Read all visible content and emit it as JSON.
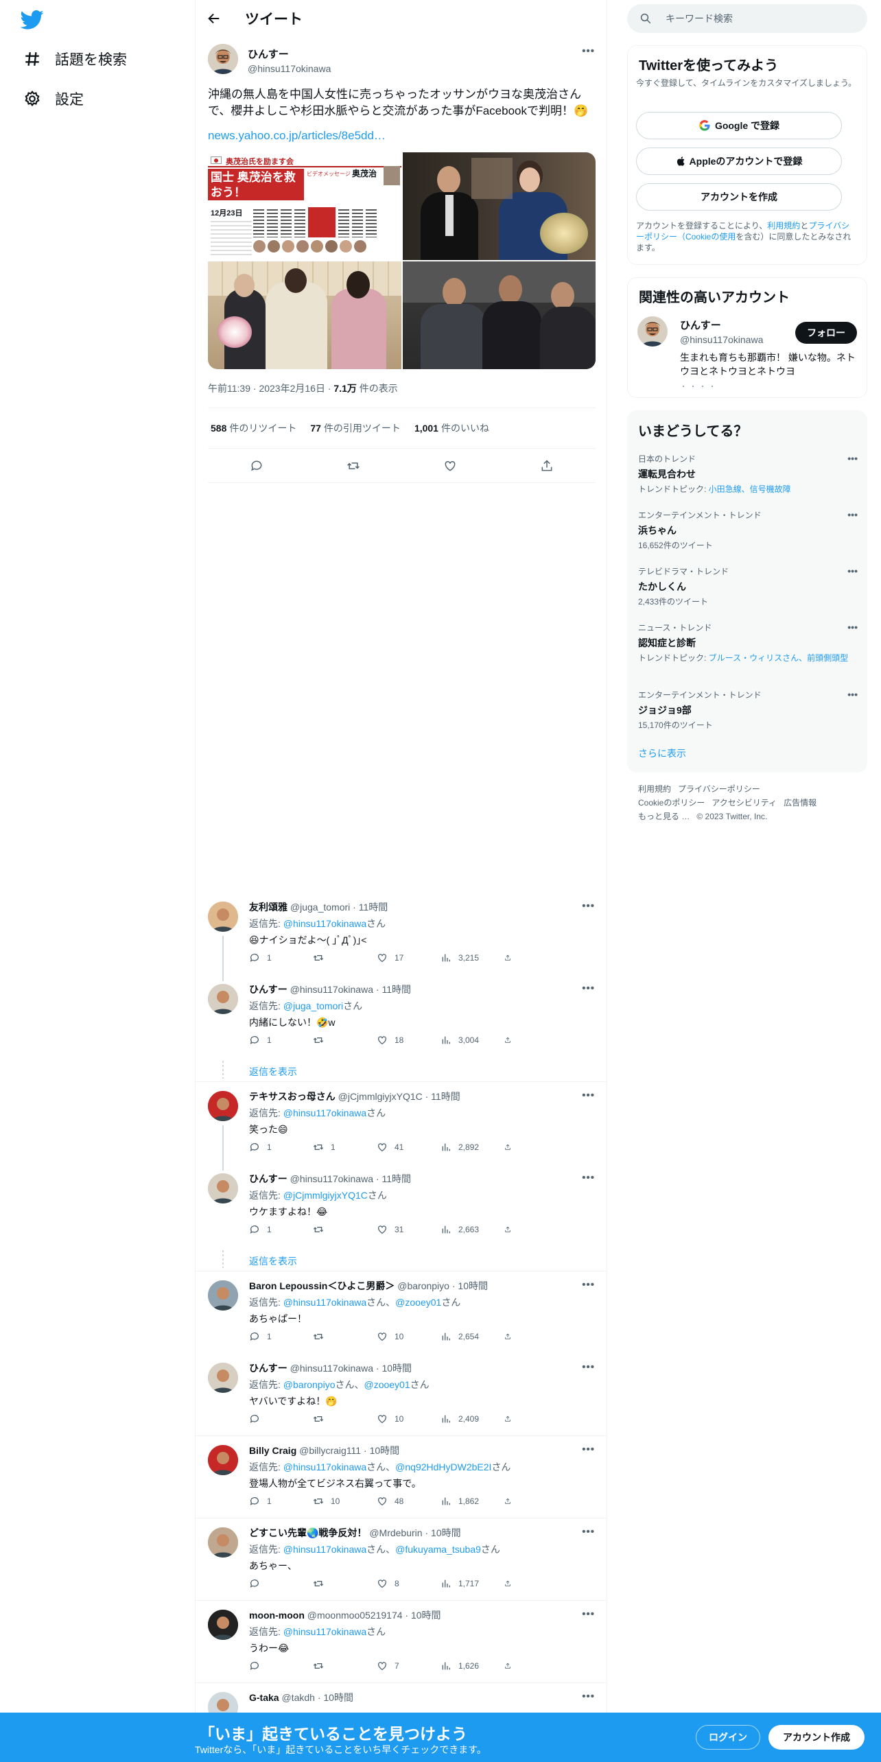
{
  "nav": {
    "explore": "話題を検索",
    "settings": "設定"
  },
  "header": {
    "title": "ツイート"
  },
  "tweet": {
    "name": "ひんすー",
    "handle": "@hinsu117okinawa",
    "text": "沖縄の無人島を中国人女性に売っちゃったオッサンがウヨな奥茂治さんで、櫻井よしこや杉田水脈やらと交流があった事がFacebookで判明！🤭",
    "link": "news.yahoo.co.jp/articles/8e5dd…",
    "time": "午前11:39",
    "date": "2023年2月16日",
    "views": "7.1万",
    "views_label": "件の表示",
    "retweets": "588",
    "retweets_label": "件のリツイート",
    "quotes": "77",
    "quotes_label": "件の引用ツイート",
    "likes": "1,001",
    "likes_label": "件のいいね",
    "image1": {
      "banner": "奥茂治氏を励ます会",
      "title": "国士 奥茂治を救おう！",
      "date": "12月23日",
      "label": "ビデオメッセージ",
      "name": "奥茂治"
    }
  },
  "replies": [
    {
      "name": "友利頌雅",
      "handle": "@juga_tomori",
      "time": "11時間",
      "to_prefix": "返信先: ",
      "to": "@hinsu117okinawa",
      "to_suffix": "さん",
      "text": "😆ナイショだよ〜( ｣ﾟДﾟ)｣<",
      "replies": "1",
      "rts": "",
      "likes": "17",
      "views": "3,215"
    },
    {
      "name": "ひんすー",
      "handle": "@hinsu117okinawa",
      "time": "11時間",
      "to_prefix": "返信先: ",
      "to": "@juga_tomori",
      "to_suffix": "さん",
      "text": "内緒にしない！🤣w",
      "replies": "1",
      "rts": "",
      "likes": "18",
      "views": "3,004"
    },
    {
      "name": "テキサスおっ母さん",
      "handle": "@jCjmmlgiyjxYQ1C",
      "time": "11時間",
      "to_prefix": "返信先: ",
      "to": "@hinsu117okinawa",
      "to_suffix": "さん",
      "text": "笑った😄",
      "replies": "1",
      "rts": "1",
      "likes": "41",
      "views": "2,892"
    },
    {
      "name": "ひんすー",
      "handle": "@hinsu117okinawa",
      "time": "11時間",
      "to_prefix": "返信先: ",
      "to": "@jCjmmlgiyjxYQ1C",
      "to_suffix": "さん",
      "text": "ウケますよね！😂",
      "replies": "1",
      "rts": "",
      "likes": "31",
      "views": "2,663"
    },
    {
      "name": "Baron Lepoussin＜ひよこ男爵＞",
      "handle": "@baronpiyo",
      "time": "10時間",
      "to_prefix": "返信先: ",
      "to": "@hinsu117okinawa",
      "to_mid": "さん、",
      "to2": "@zooey01",
      "to_suffix": "さん",
      "text": "あちゃぱー！",
      "replies": "1",
      "rts": "",
      "likes": "10",
      "views": "2,654"
    },
    {
      "name": "ひんすー",
      "handle": "@hinsu117okinawa",
      "time": "10時間",
      "to_prefix": "返信先: ",
      "to": "@baronpiyo",
      "to_mid": "さん、",
      "to2": "@zooey01",
      "to_suffix": "さん",
      "text": "ヤバいですよね！🤭",
      "replies": "",
      "rts": "",
      "likes": "10",
      "views": "2,409"
    },
    {
      "name": "Billy Craig",
      "handle": "@billycraig111",
      "time": "10時間",
      "to_prefix": "返信先: ",
      "to": "@hinsu117okinawa",
      "to_mid": "さん、",
      "to2": "@nq92HdHyDW2bE2I",
      "to_suffix": "さん",
      "text": "登場人物が全てビジネス右翼って事で。",
      "replies": "1",
      "rts": "10",
      "likes": "48",
      "views": "1,862"
    },
    {
      "name": "どすこい先輩🌏戦争反対！",
      "handle": "@Mrdeburin",
      "time": "10時間",
      "to_prefix": "返信先: ",
      "to": "@hinsu117okinawa",
      "to_mid": "さん、",
      "to2": "@fukuyama_tsuba9",
      "to_suffix": "さん",
      "text": "あちゃー、",
      "replies": "",
      "rts": "",
      "likes": "8",
      "views": "1,717"
    },
    {
      "name": "moon-moon",
      "handle": "@moonmoo05219174",
      "time": "10時間",
      "to_prefix": "返信先: ",
      "to": "@hinsu117okinawa",
      "to_suffix": "さん",
      "text": "うわー😂",
      "replies": "",
      "rts": "",
      "likes": "7",
      "views": "1,626"
    },
    {
      "name": "G-taka",
      "handle": "@takdh",
      "time": "10時間",
      "to_prefix": "",
      "to": "",
      "to_suffix": "",
      "text": "",
      "replies": "",
      "rts": "",
      "likes": "",
      "views": ""
    }
  ],
  "show_replies": "返信を表示",
  "right": {
    "search_placeholder": "キーワード検索",
    "signup_title": "Twitterを使ってみよう",
    "signup_desc": "今すぐ登録して、タイムラインをカスタマイズしましょう。",
    "google_btn": "Google で登録",
    "apple_btn": "Appleのアカウントで登録",
    "create_btn": "アカウントを作成",
    "terms_1": "アカウントを登録することにより、",
    "terms_link1": "利用規約",
    "terms_2": "と",
    "terms_link2": "プライバシーポリシー（Cookieの使用",
    "terms_3": "を含む）に同意したとみなされます。",
    "related_title": "関連性の高いアカウント",
    "rel_name": "ひんすー",
    "rel_handle": "@hinsu117okinawa",
    "follow": "フォロー",
    "rel_bio": "生まれも育ちも那覇市！ 嫌いな物。ネトウヨとネトウヨとネトウヨ",
    "rel_dots": "・・・・",
    "trends_title": "いまどうしてる？",
    "trends": [
      {
        "cat": "日本のトレンド",
        "name": "運転見合わせ",
        "sub_prefix": "トレンドトピック: ",
        "sub_link": "小田急線、信号機故障",
        "sub": ""
      },
      {
        "cat": "エンターテインメント・トレンド",
        "name": "浜ちゃん",
        "sub_prefix": "",
        "sub_link": "",
        "sub": "16,652件のツイート"
      },
      {
        "cat": "テレビドラマ・トレンド",
        "name": "たかしくん",
        "sub_prefix": "",
        "sub_link": "",
        "sub": "2,433件のツイート"
      },
      {
        "cat": "ニュース・トレンド",
        "name": "認知症と診断",
        "sub_prefix": "トレンドトピック: ",
        "sub_link": "ブルース・ウィリスさん、前頭側頭型",
        "sub": ""
      },
      {
        "cat": "エンターテインメント・トレンド",
        "name": "ジョジョ9部",
        "sub_prefix": "",
        "sub_link": "",
        "sub": "15,170件のツイート"
      }
    ],
    "show_more": "さらに表示",
    "footer": {
      "terms": "利用規約",
      "privacy": "プライバシーポリシー",
      "cookie": "Cookieのポリシー",
      "access": "アクセシビリティ",
      "ads": "広告情報",
      "more": "もっと見る …",
      "copy": "© 2023 Twitter, Inc."
    }
  },
  "bottom": {
    "title": "「いま」起きていることを見つけよう",
    "sub": "Twitterなら、「いま」起きていることをいち早くチェックできます。",
    "login": "ログイン",
    "signup": "アカウント作成"
  },
  "colors": {
    "accent": "#1d9bf0",
    "text": "#0f1419",
    "muted": "#536471"
  }
}
